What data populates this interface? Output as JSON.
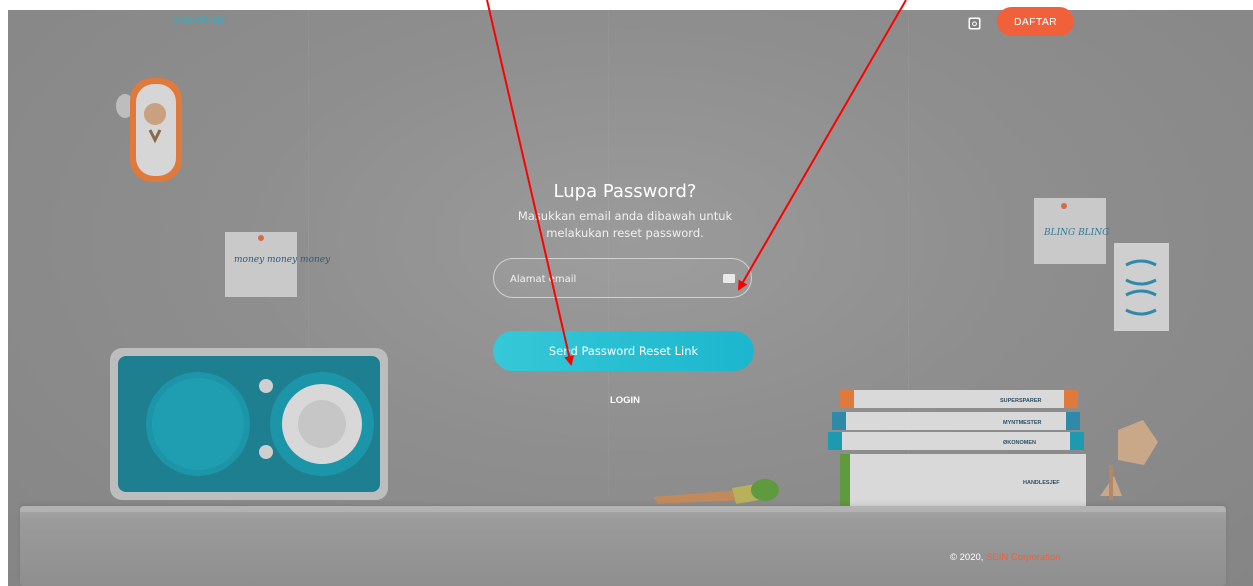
{
  "header": {
    "brand": "SINKRON",
    "instagram_icon": "instagram-icon",
    "register_label": "DAFTAR"
  },
  "form": {
    "title": "Lupa Password?",
    "description": "Masukkan email anda dibawah untuk melakukan reset password.",
    "email_placeholder": "Alamat email",
    "email_icon": "envelope-icon",
    "submit_label": "Send Password Reset Link",
    "login_link": "LOGIN"
  },
  "footer": {
    "copyright": "© 2020,",
    "company": "SEIN Corporation"
  },
  "decor": {
    "sticky_notes": [
      "money money money",
      "BLING BLING"
    ],
    "book_spines": [
      "SUPERSPARER",
      "MYNTMESTER",
      "ØKONOMEN",
      "HANDLESJEF"
    ]
  },
  "colors": {
    "accent_orange": "#f0613b",
    "accent_teal": "#1fb6c9",
    "annotation_arrow": "#ff0000"
  }
}
